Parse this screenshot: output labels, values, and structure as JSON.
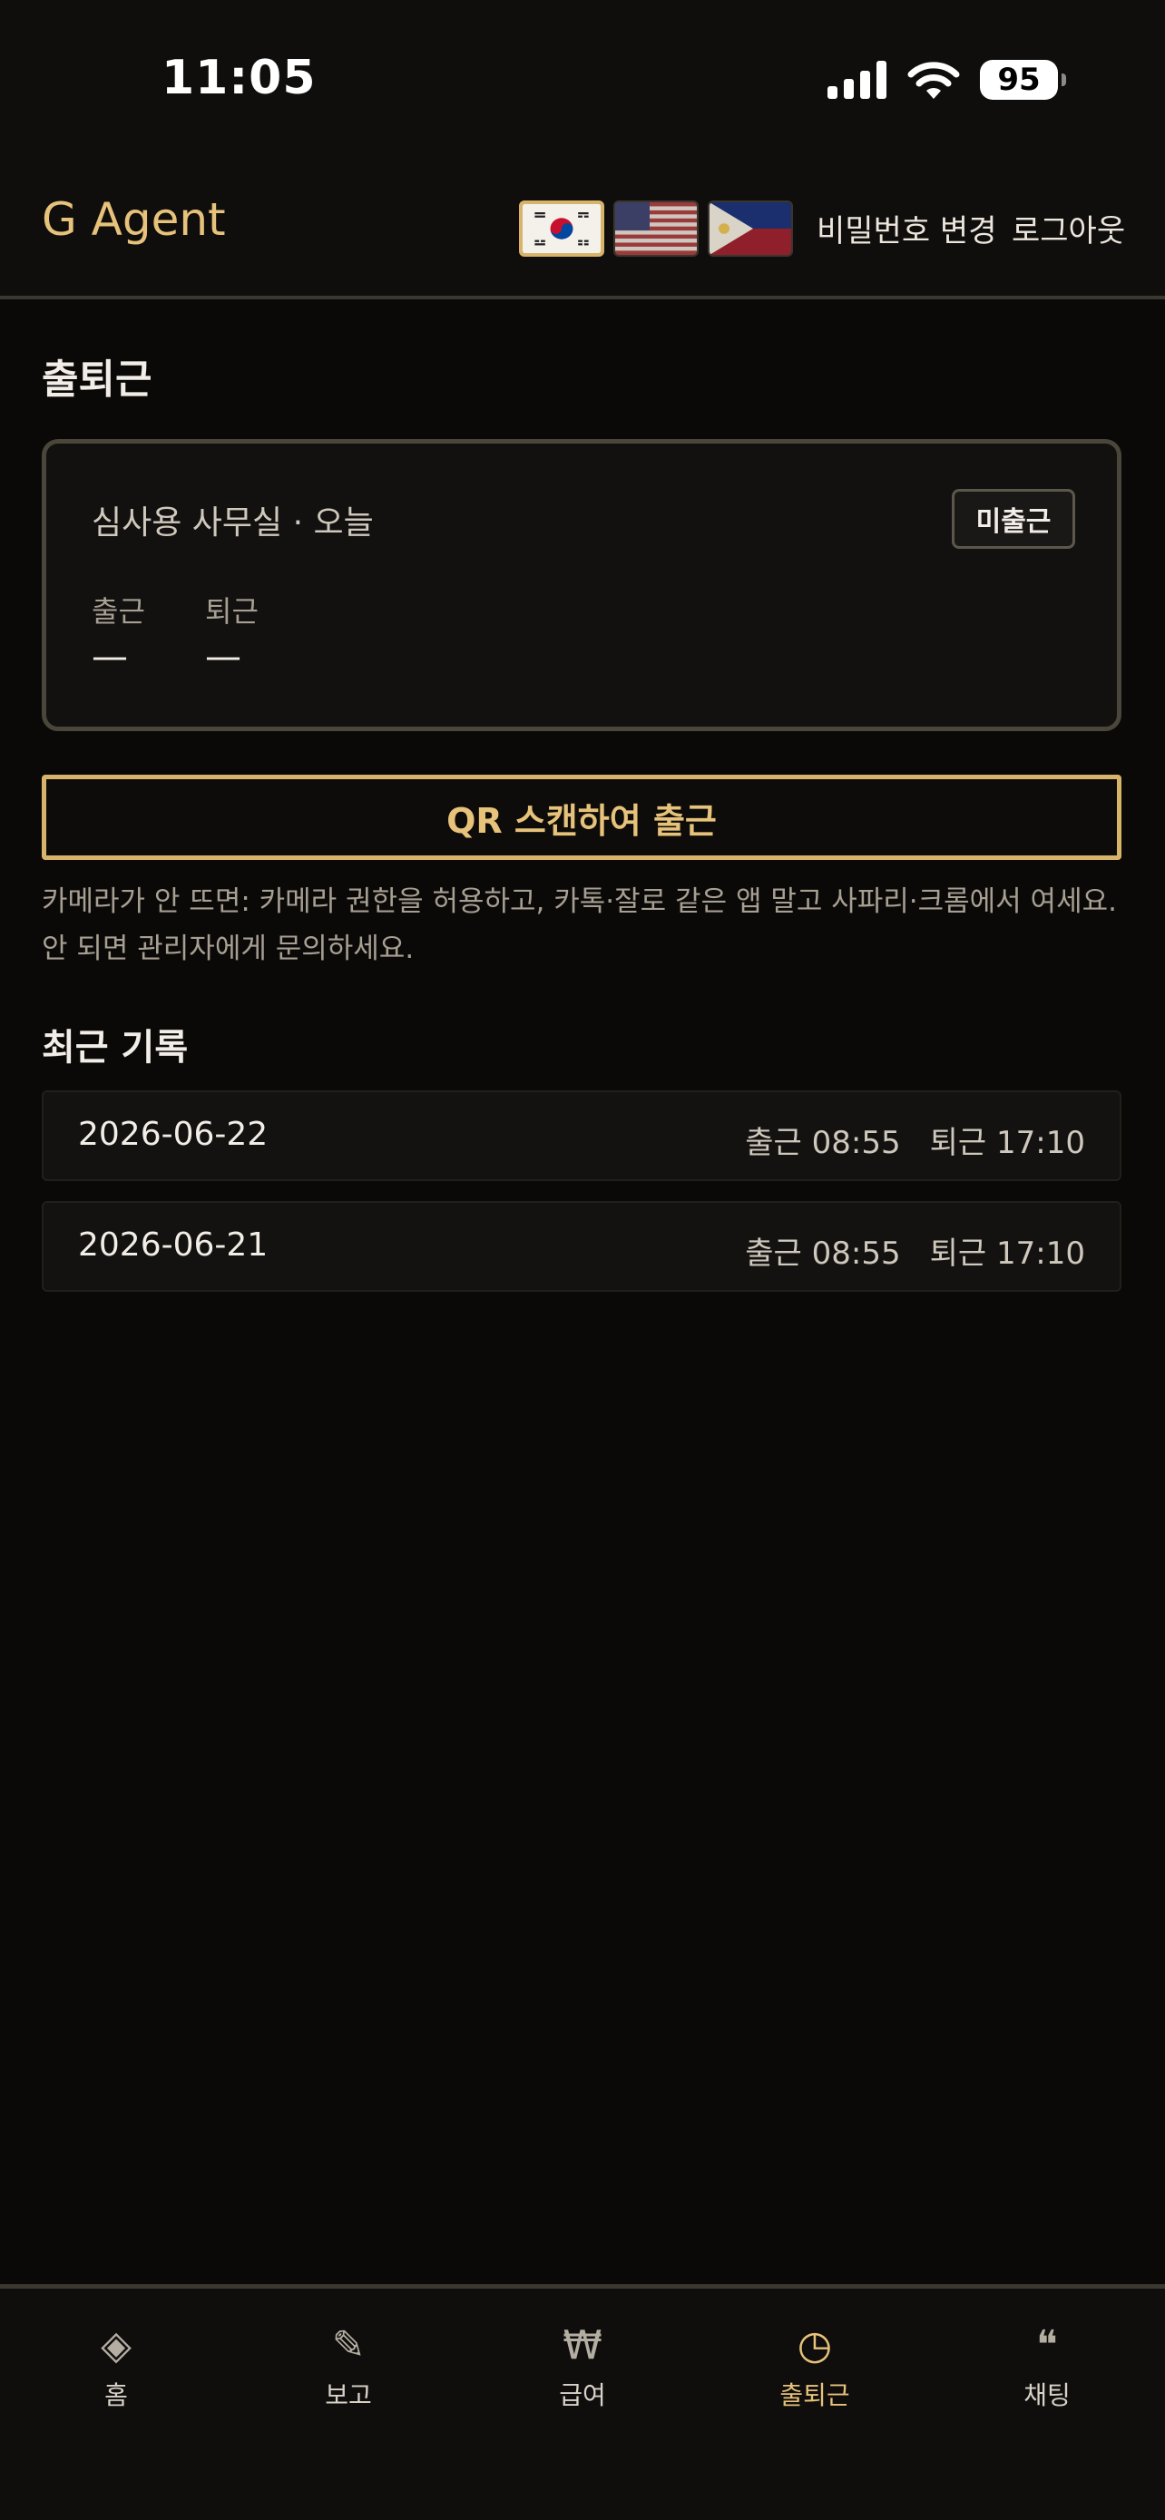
{
  "status_bar": {
    "time": "11:05",
    "battery": "95"
  },
  "header": {
    "brand": "G Agent",
    "languages": [
      {
        "code": "ko",
        "active": true
      },
      {
        "code": "en",
        "active": false
      },
      {
        "code": "ph",
        "active": false
      }
    ],
    "change_password": "비밀번호 변경",
    "logout": "로그아웃"
  },
  "attendance": {
    "title": "출퇴근",
    "location": "심사용 사무실 · 오늘",
    "status_badge": "미출근",
    "check_in_label": "출근",
    "check_in_value": "—",
    "check_out_label": "퇴근",
    "check_out_value": "—",
    "scan_button": "QR 스캔하여 출근",
    "help_text": "카메라가 안 뜨면: 카메라 권한을 허용하고, 카톡·잘로 같은 앱 말고 사파리·크롬에서 여세요. 안 되면 관리자에게 문의하세요."
  },
  "recent": {
    "title": "최근 기록",
    "records": [
      {
        "date": "2026-06-22",
        "check_in": "출근 08:55",
        "check_out": "퇴근 17:10"
      },
      {
        "date": "2026-06-21",
        "check_in": "출근 08:55",
        "check_out": "퇴근 17:10"
      }
    ]
  },
  "tabs": [
    {
      "label": "홈",
      "icon": "◈",
      "icon_name": "home-diamond-icon",
      "active": false
    },
    {
      "label": "보고",
      "icon": "✎",
      "icon_name": "pencil-icon",
      "active": false
    },
    {
      "label": "급여",
      "icon": "₩",
      "icon_name": "won-icon",
      "active": false
    },
    {
      "label": "출퇴근",
      "icon": "◷",
      "icon_name": "clock-icon",
      "active": true
    },
    {
      "label": "채팅",
      "icon": "❝",
      "icon_name": "quote-icon",
      "active": false
    }
  ],
  "colors": {
    "accent": "#e6c27a",
    "background": "#0a0908"
  }
}
